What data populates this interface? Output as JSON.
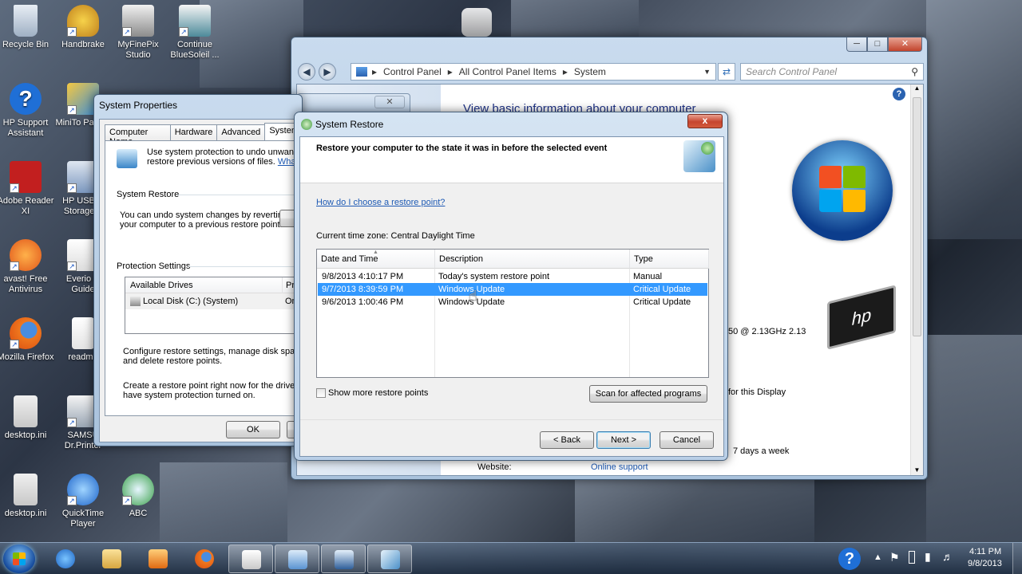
{
  "desktop": {
    "icons": [
      {
        "label": "Recycle Bin"
      },
      {
        "label": "Handbrake"
      },
      {
        "label": "MyFinePix Studio"
      },
      {
        "label": "Continue BlueSoleil ..."
      },
      {
        "label": "HP Support Assistant"
      },
      {
        "label": "MiniTo Partitio"
      },
      {
        "label": "Adobe Reader XI"
      },
      {
        "label": "HP USB D Storage F"
      },
      {
        "label": "avast! Free Antivirus"
      },
      {
        "label": "Everio U Guide"
      },
      {
        "label": "Mozilla Firefox"
      },
      {
        "label": "readme"
      },
      {
        "label": "desktop.ini"
      },
      {
        "label": "SAMSU Dr.Printer"
      },
      {
        "label": "desktop.ini"
      },
      {
        "label": "QuickTime Player"
      },
      {
        "label": "ABC"
      }
    ]
  },
  "control_panel": {
    "breadcrumb": [
      "Control Panel",
      "All Control Panel Items",
      "System"
    ],
    "search_placeholder": "Search Control Panel",
    "heading": "View basic information about your computer",
    "processor_text": "50  @ 2.13GHz   2.13",
    "display_text": "for this Display",
    "support_hours": "7 days a week",
    "website_label": "Website:",
    "website_link": "Online support",
    "hp_logo": "hp"
  },
  "system_properties": {
    "title": "System Properties",
    "tabs": [
      "Computer Name",
      "Hardware",
      "Advanced",
      "System"
    ],
    "intro_text": "Use system protection to undo unwanted",
    "intro_text2": "restore previous versions of files.",
    "intro_link": "What is",
    "system_restore_group": "System Restore",
    "restore_desc": "You can undo system changes by reverting",
    "restore_desc2": "your computer to a previous restore point.",
    "protection_group": "Protection Settings",
    "col_drives": "Available Drives",
    "col_protection": "Prot",
    "drive_name": "Local Disk (C:) (System)",
    "drive_status": "On",
    "configure_text": "Configure restore settings, manage disk space,",
    "configure_text2": "and delete restore points.",
    "create_text": "Create a restore point right now for the drives tha",
    "create_text2": "have system protection turned on.",
    "ok_label": "OK"
  },
  "system_restore": {
    "title": "System Restore",
    "heading": "Restore your computer to the state it was in before the selected event",
    "help_link": "How do I choose a restore point?",
    "timezone": "Current time zone: Central Daylight Time",
    "columns": [
      "Date and Time",
      "Description",
      "Type"
    ],
    "rows": [
      {
        "date": "9/8/2013 4:10:17 PM",
        "desc": "Today's system restore point",
        "type": "Manual",
        "selected": false
      },
      {
        "date": "9/7/2013 8:39:59 PM",
        "desc": "Windows Update",
        "type": "Critical Update",
        "selected": true
      },
      {
        "date": "9/6/2013 1:00:46 PM",
        "desc": "Windows Update",
        "type": "Critical Update",
        "selected": false
      }
    ],
    "show_more_label": "Show more restore points",
    "show_more_checked": false,
    "scan_label": "Scan for affected programs",
    "back_label": "< Back",
    "next_label": "Next >",
    "cancel_label": "Cancel",
    "close_glyph": "x"
  },
  "taskbar": {
    "time": "4:11 PM",
    "date": "9/8/2013"
  },
  "colors": {
    "selection": "#3399ff",
    "link": "#1e5ab4",
    "title_bar": "#b9cfe7"
  }
}
